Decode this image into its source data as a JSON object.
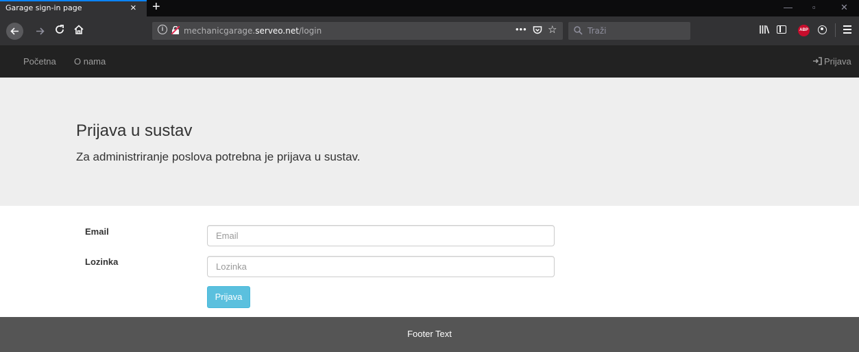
{
  "browser": {
    "tab_title": "Garage sign-in page",
    "tab_close": "×",
    "new_tab": "+",
    "window_controls": {
      "minimize": "—",
      "maximize": "▫",
      "close": "✕"
    },
    "url_prefix": "mechanicgarage.",
    "url_host": "serveo.net",
    "url_path": "/login",
    "page_actions": "•••",
    "search_placeholder": "Traži",
    "info_glyph": "i",
    "abp_label": "ABP",
    "icons": [
      "back-icon",
      "forward-icon",
      "reload-icon",
      "home-icon",
      "info-icon",
      "insecure-lock-icon",
      "pocket-icon",
      "star-icon",
      "search-icon",
      "library-icon",
      "sidebar-icon",
      "abp-icon",
      "account-icon",
      "menu-icon"
    ]
  },
  "site_nav": {
    "home": "Početna",
    "about": "O nama",
    "login": "Prijava"
  },
  "jumbotron": {
    "title": "Prijava u sustav",
    "lead": "Za administriranje poslova potrebna je prijava u sustav."
  },
  "form": {
    "email_label": "Email",
    "email_placeholder": "Email",
    "password_label": "Lozinka",
    "password_placeholder": "Lozinka",
    "submit_label": "Prijava"
  },
  "footer": {
    "text": "Footer Text"
  },
  "colors": {
    "navbar_dark": "#222222",
    "jumbotron_bg": "#eeeeee",
    "button_info": "#5bc0de",
    "footer_bg": "#555555"
  }
}
